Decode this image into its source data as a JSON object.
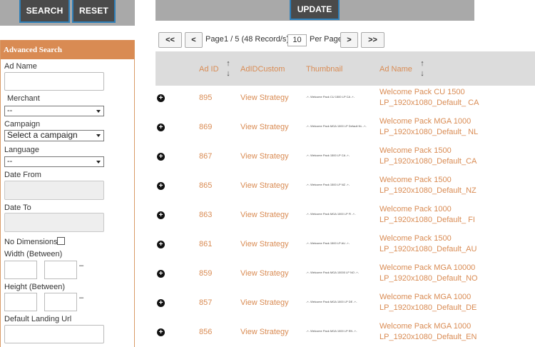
{
  "search_panel": {
    "search_label": "SEARCH",
    "reset_label": "RESET",
    "title": "Advanced Search",
    "fields": {
      "ad_name": "Ad Name",
      "merchant": "Merchant",
      "merchant_value": "--",
      "campaign": "Campaign",
      "campaign_value": "Select a campaign",
      "language": "Language",
      "language_value": "--",
      "date_from": "Date From",
      "date_to": "Date To",
      "no_dimensions": "No Dimensions",
      "width": "Width (Between)",
      "height": "Height (Between)",
      "range_sep": "–",
      "landing_url": "Default Landing Url"
    }
  },
  "toolbar": {
    "update_label": "UPDATE"
  },
  "pager": {
    "first": "<<",
    "prev": "<",
    "label_page": "Page",
    "page_info": "1 / 5 (48 Record/s)",
    "per_page_value": "10",
    "label_per_page": "Per Page",
    "next": ">",
    "last": ">>"
  },
  "table": {
    "headers": {
      "ad_id": "Ad ID",
      "custom": "AdIDCustom",
      "thumbnail": "Thumbnail",
      "ad_name": "Ad Name"
    },
    "sort_arrows": {
      "up": "↑",
      "down": "↓"
    },
    "expand_symbol": "+",
    "rows": [
      {
        "id": "895",
        "link": "View Strategy",
        "thumb": "-+- Welcome Pack CU 1500 LP CA -+-",
        "name": "Welcome Pack CU 1500 LP_1920x1080_Default_ CA"
      },
      {
        "id": "869",
        "link": "View Strategy",
        "thumb": "-+- Welcome Pack MGA 1000 LP Default NL -+-",
        "name": "Welcome Pack MGA 1000 LP_1920x1080_Default_ NL"
      },
      {
        "id": "867",
        "link": "View Strategy",
        "thumb": "-+- Welcome Pack 1500 LP CA -+-",
        "name": "Welcome Pack 1500 LP_1920x1080_Default_CA"
      },
      {
        "id": "865",
        "link": "View Strategy",
        "thumb": "-+- Welcome Pack 1500 LP NZ -+-",
        "name": "Welcome Pack 1500 LP_1920x1080_Default_NZ"
      },
      {
        "id": "863",
        "link": "View Strategy",
        "thumb": "-+- Welcome Pack MGA 1000 LP FI -+-",
        "name": "Welcome Pack 1000 LP_1920x1080_Default_ FI"
      },
      {
        "id": "861",
        "link": "View Strategy",
        "thumb": "-+- Welcome Pack 1500 LP AU -+-",
        "name": "Welcome Pack 1500 LP_1920x1080_Default_AU"
      },
      {
        "id": "859",
        "link": "View Strategy",
        "thumb": "-+- Welcome Pack MGA 10000 LP NO -+-",
        "name": "Welcome Pack MGA 10000 LP_1920x1080_Default_NO"
      },
      {
        "id": "857",
        "link": "View Strategy",
        "thumb": "-+- Welcome Pack MGA 1000 LP DE -+-",
        "name": "Welcome Pack MGA 1000 LP_1920x1080_Default_DE"
      },
      {
        "id": "856",
        "link": "View Strategy",
        "thumb": "-+- Welcome Pack MGA 1000 LP EN -+-",
        "name": "Welcome Pack MGA 1000 LP_1920x1080_Default_EN"
      }
    ]
  },
  "colors": {
    "accent": "#d98b53",
    "toolbar": "#a9a9a9",
    "button": "#4a4a4a",
    "button_border": "#2e7fb8"
  }
}
